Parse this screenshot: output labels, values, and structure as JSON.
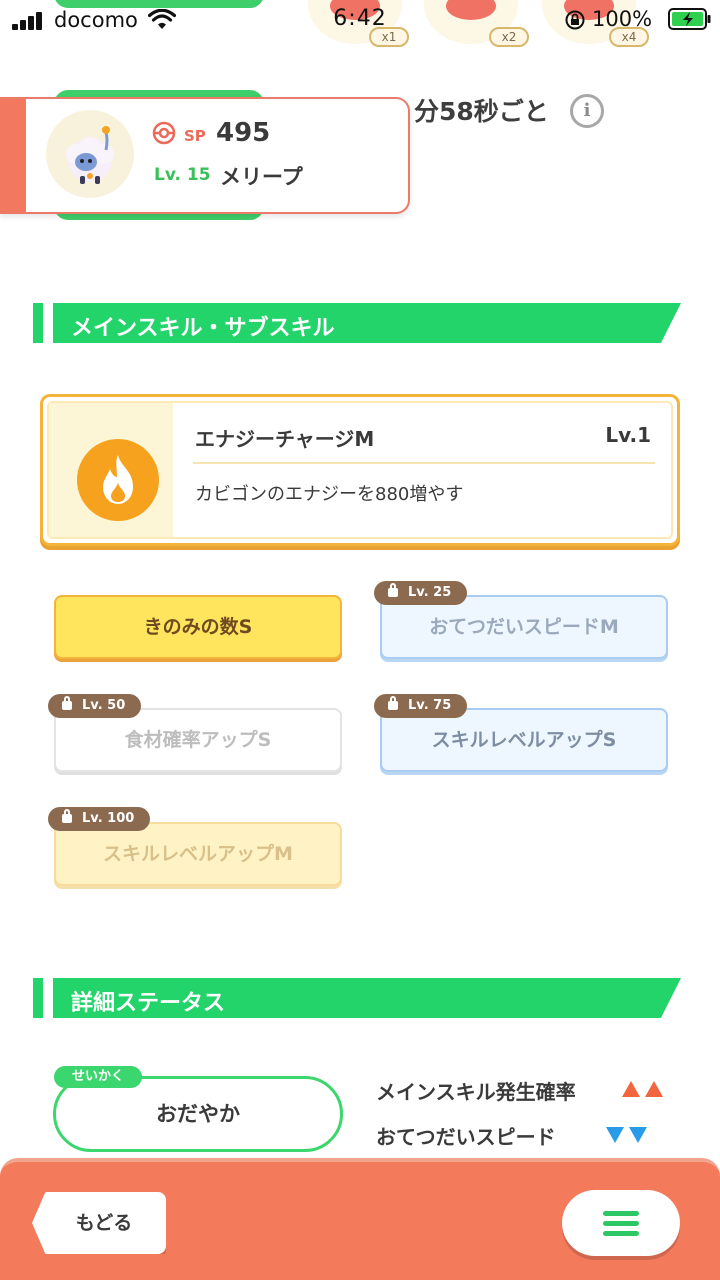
{
  "status_bar": {
    "carrier": "docomo",
    "time": "6:42",
    "battery": "100%"
  },
  "helpers": [
    {
      "multiplier": "x1"
    },
    {
      "multiplier": "x2"
    },
    {
      "multiplier": "x4"
    }
  ],
  "header": {
    "interval_text": "分58秒ごと"
  },
  "pokemon": {
    "sp_label": "SP",
    "sp_value": "495",
    "level": "Lv. 15",
    "name": "メリープ"
  },
  "skills_section": {
    "title": "メインスキル・サブスキル",
    "main_skill": {
      "name": "エナジーチャージM",
      "level": "Lv.1",
      "description": "カビゴンのエナジーを880増やす"
    },
    "sub_skills": [
      {
        "name": "きのみの数S",
        "lock_level": ""
      },
      {
        "name": "おてつだいスピードM",
        "lock_level": "Lv. 25"
      },
      {
        "name": "食材確率アップS",
        "lock_level": "Lv. 50"
      },
      {
        "name": "スキルレベルアップS",
        "lock_level": "Lv. 75"
      },
      {
        "name": "スキルレベルアップM",
        "lock_level": "Lv. 100"
      }
    ]
  },
  "details_section": {
    "title": "詳細ステータス",
    "nature_tag": "せいかく",
    "nature": "おだやか",
    "effects": [
      {
        "label": "メインスキル発生確率",
        "direction": "up",
        "color": "#f2663e"
      },
      {
        "label": "おてつだいスピード",
        "direction": "down",
        "color": "#2a9be8"
      }
    ]
  },
  "footer": {
    "back_label": "もどる"
  },
  "colors": {
    "green": "#22d46a",
    "orange": "#f47a5c",
    "gold": "#f4b43a"
  }
}
